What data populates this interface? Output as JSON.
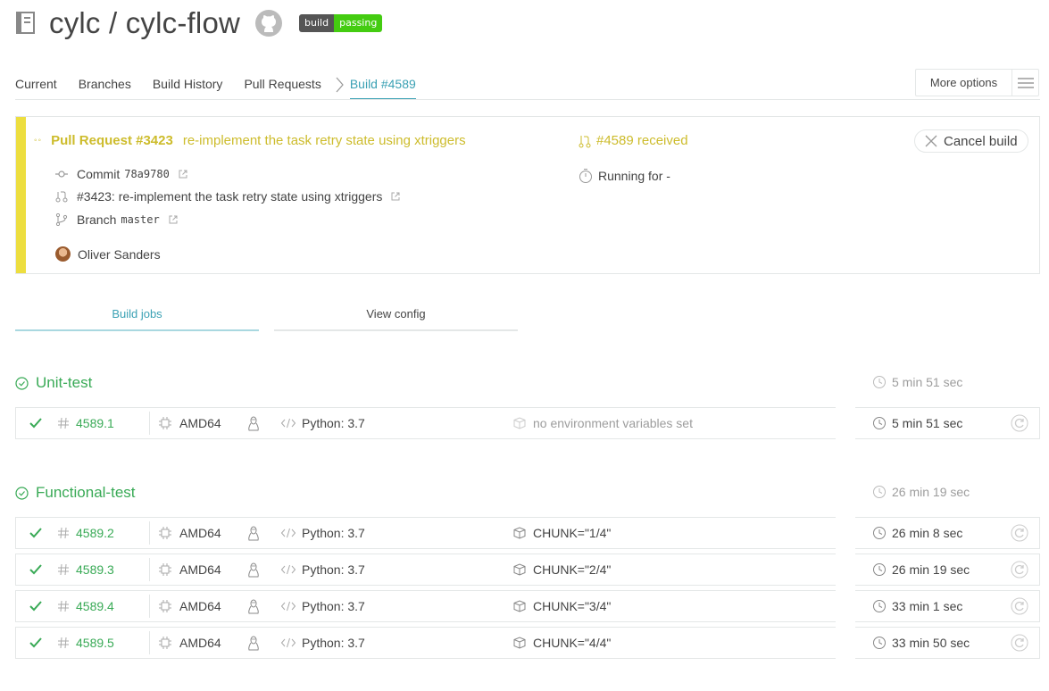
{
  "repo": {
    "title": "cylc / cylc-flow",
    "badge_left": "build",
    "badge_right": "passing"
  },
  "nav": {
    "tabs": [
      "Current",
      "Branches",
      "Build History",
      "Pull Requests"
    ],
    "active": "Build #4589",
    "more_options": "More options"
  },
  "build": {
    "pr_number": "Pull Request #3423",
    "pr_message": "re-implement the task retry state using xtriggers",
    "commit_label": "Commit",
    "commit_sha": "78a9780",
    "compare": "#3423: re-implement the task retry state using xtriggers",
    "branch_label": "Branch",
    "branch": "master",
    "author": "Oliver Sanders",
    "status": "#4589 received",
    "running": "Running for -",
    "cancel": "Cancel build",
    "state_color": "#edde3f"
  },
  "subtabs": {
    "jobs": "Build jobs",
    "config": "View config"
  },
  "stages": [
    {
      "name": "Unit-test",
      "time": "5 min 51 sec",
      "jobs": [
        {
          "num": "4589.1",
          "arch": "AMD64",
          "lang": "Python: 3.7",
          "env": "no environment variables set",
          "time": "5 min 51 sec"
        }
      ]
    },
    {
      "name": "Functional-test",
      "time": "26 min 19 sec",
      "jobs": [
        {
          "num": "4589.2",
          "arch": "AMD64",
          "lang": "Python: 3.7",
          "env": "CHUNK=\"1/4\"",
          "time": "26 min 8 sec"
        },
        {
          "num": "4589.3",
          "arch": "AMD64",
          "lang": "Python: 3.7",
          "env": "CHUNK=\"2/4\"",
          "time": "26 min 19 sec"
        },
        {
          "num": "4589.4",
          "arch": "AMD64",
          "lang": "Python: 3.7",
          "env": "CHUNK=\"3/4\"",
          "time": "33 min 1 sec"
        },
        {
          "num": "4589.5",
          "arch": "AMD64",
          "lang": "Python: 3.7",
          "env": "CHUNK=\"4/4\"",
          "time": "33 min 50 sec"
        }
      ]
    }
  ]
}
